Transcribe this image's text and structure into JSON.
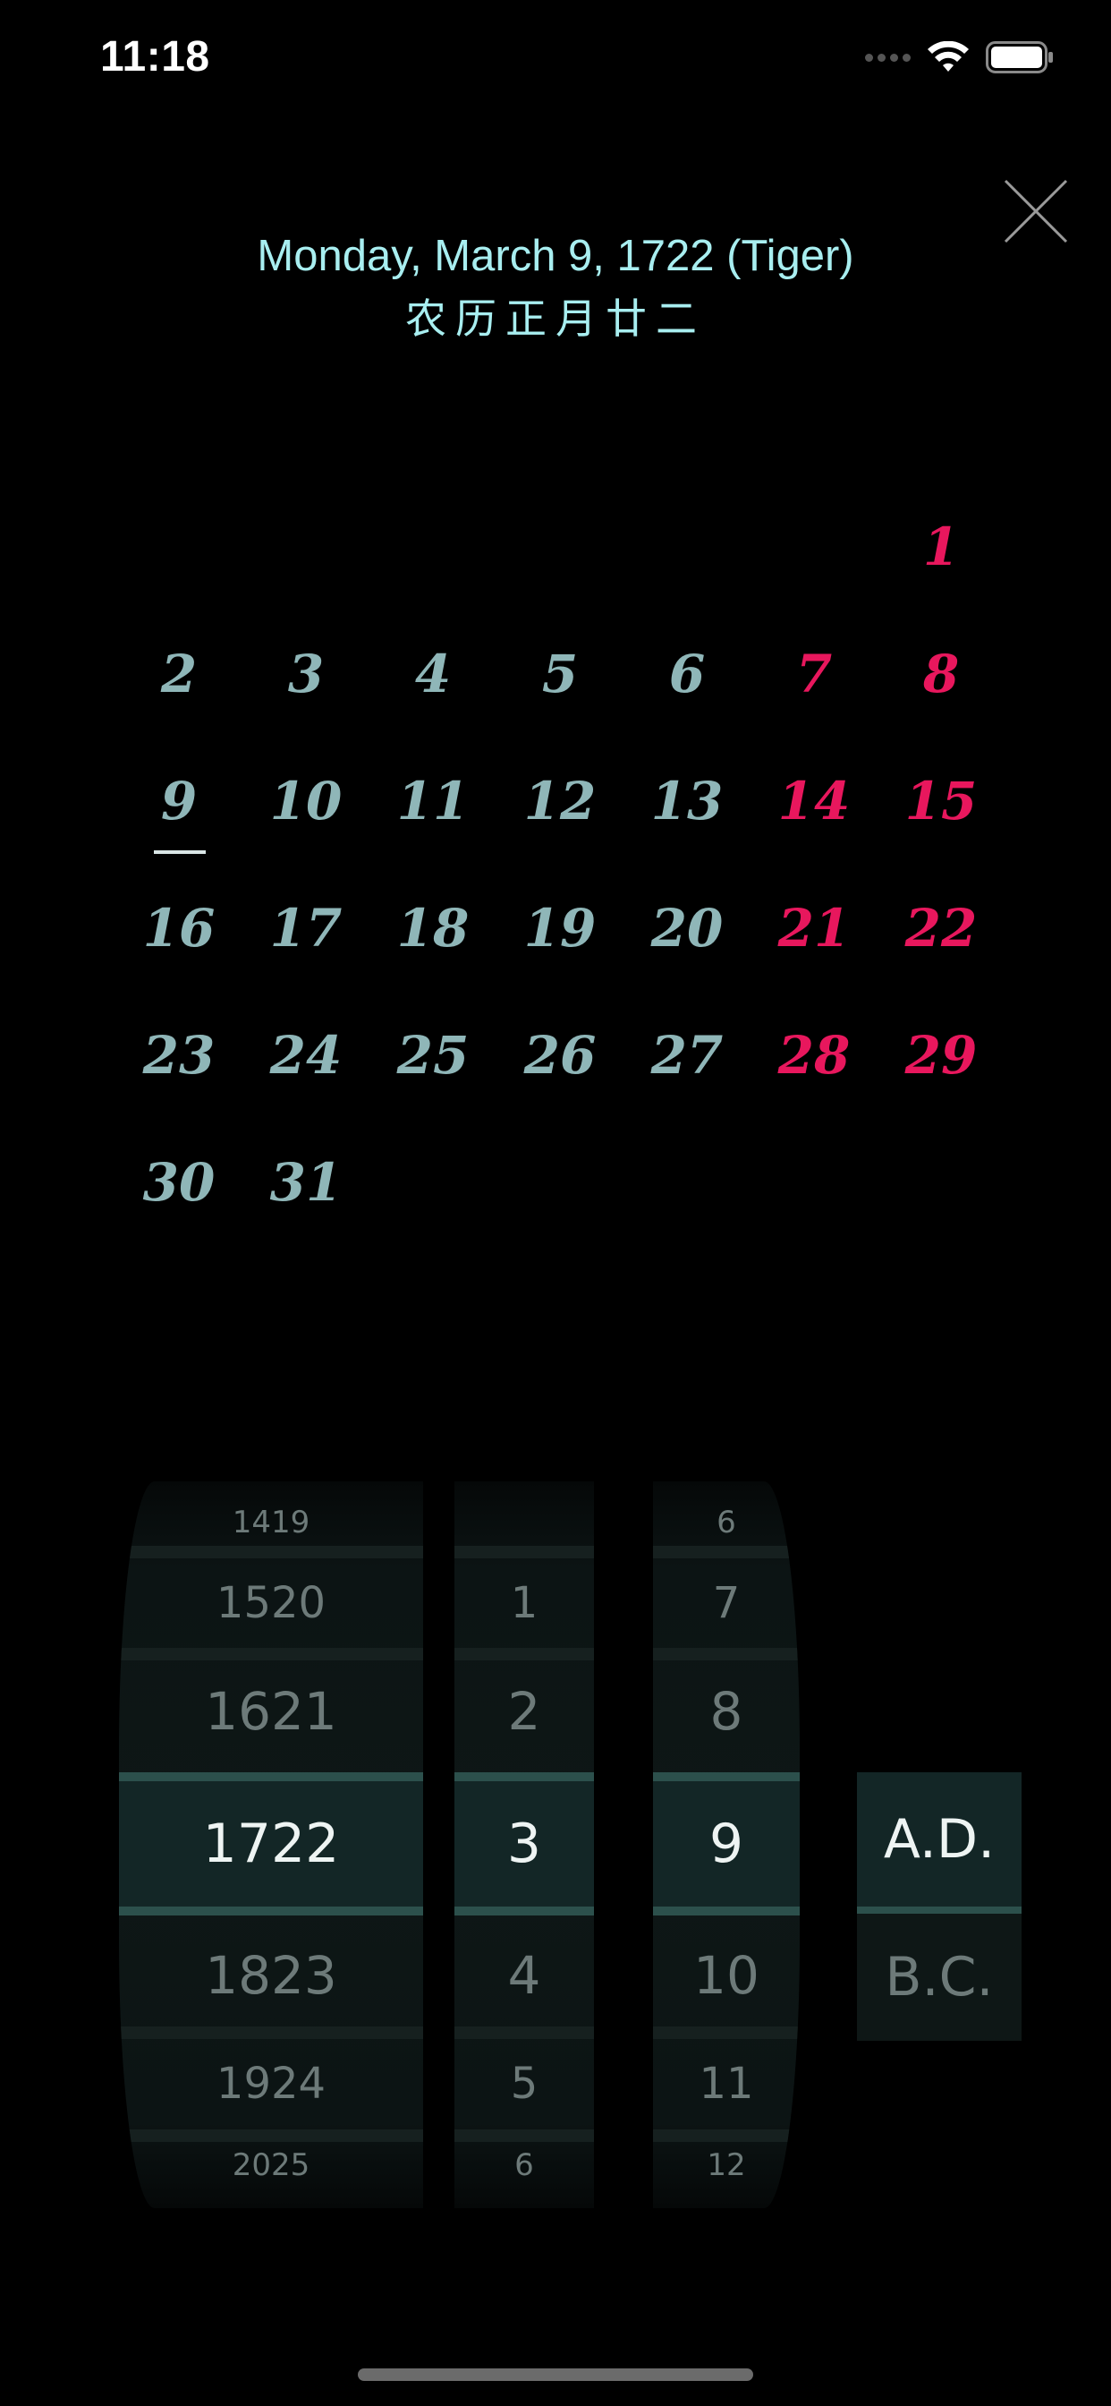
{
  "status_bar": {
    "time": "11:18"
  },
  "header": {
    "date_line": "Monday, March 9, 1722 (Tiger)",
    "lunar_line": "农历正月廿二"
  },
  "calendar": {
    "selected_day": "9",
    "accent_color": "#e8175d",
    "day_color": "#8fb6b8",
    "rows": [
      [
        null,
        null,
        null,
        null,
        null,
        null,
        "1"
      ],
      [
        "2",
        "3",
        "4",
        "5",
        "6",
        "7",
        "8"
      ],
      [
        "9",
        "10",
        "11",
        "12",
        "13",
        "14",
        "15"
      ],
      [
        "16",
        "17",
        "18",
        "19",
        "20",
        "21",
        "22"
      ],
      [
        "23",
        "24",
        "25",
        "26",
        "27",
        "28",
        "29"
      ],
      [
        "30",
        "31",
        null,
        null,
        null,
        null,
        null
      ]
    ]
  },
  "picker": {
    "year": {
      "above": [
        "1419",
        "1520",
        "1621"
      ],
      "selected": "1722",
      "below": [
        "1823",
        "1924",
        "2025"
      ]
    },
    "century_digit": {
      "above": [
        "1",
        "2"
      ],
      "selected": "3",
      "below": [
        "4",
        "5",
        "6"
      ]
    },
    "unit_digit": {
      "above": [
        "6",
        "7",
        "8"
      ],
      "selected": "9",
      "below": [
        "10",
        "11",
        "12"
      ]
    },
    "era": {
      "selected": "A.D.",
      "other": "B.C."
    }
  }
}
